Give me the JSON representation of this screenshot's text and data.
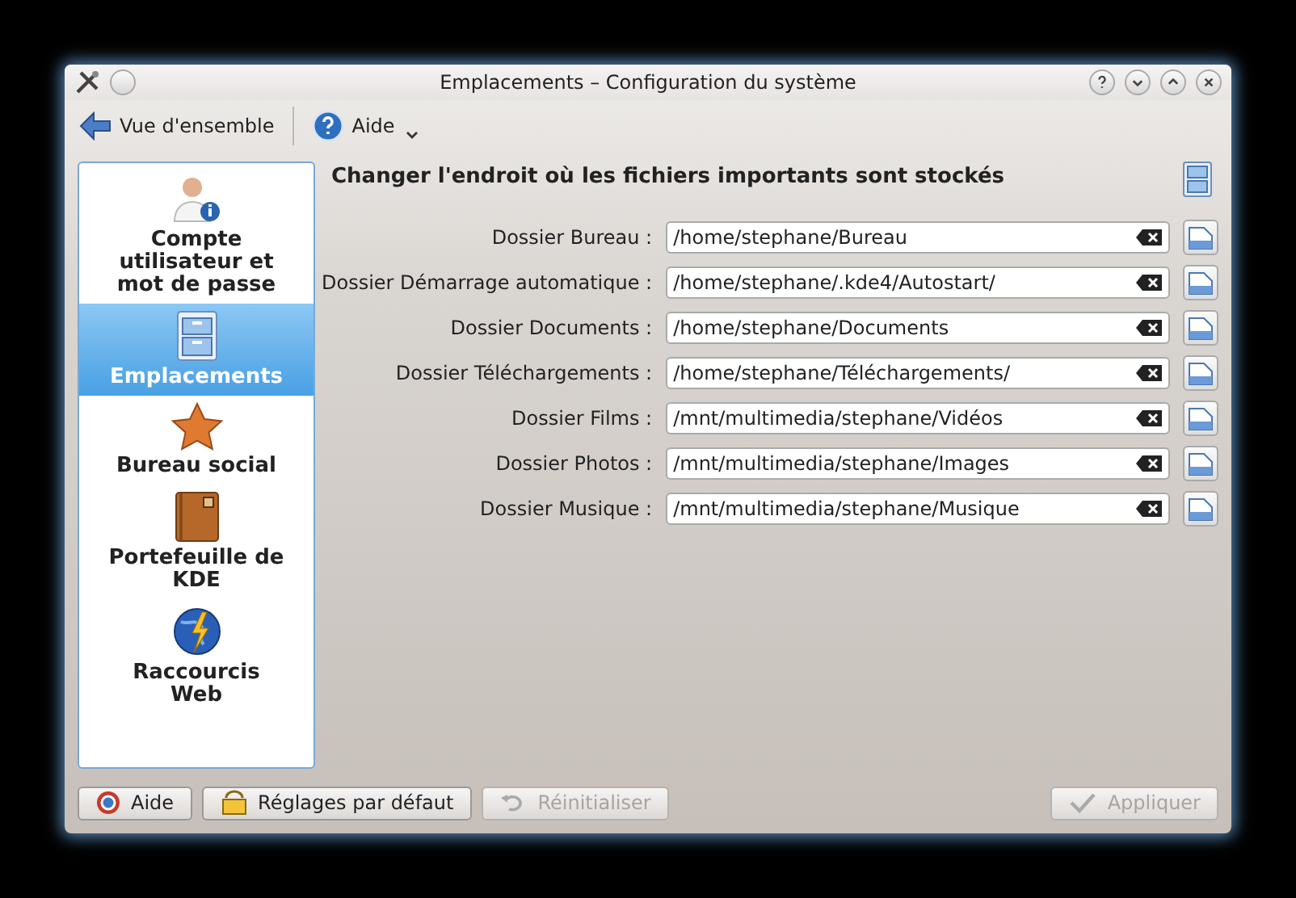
{
  "window": {
    "title": "Emplacements – Configuration du système"
  },
  "toolbar": {
    "items": [
      {
        "label": "Vue d'ensemble",
        "kind": "back"
      },
      {
        "label": "Aide",
        "kind": "help"
      }
    ]
  },
  "sidebar": {
    "items": [
      {
        "label": "Compte utilisateur et mot de passe",
        "kind": "user",
        "selected": false
      },
      {
        "label": "Emplacements",
        "kind": "cabinet",
        "selected": true
      },
      {
        "label": "Bureau social",
        "kind": "star",
        "selected": false
      },
      {
        "label": "Portefeuille de KDE",
        "kind": "wallet",
        "selected": false
      },
      {
        "label": "Raccourcis Web",
        "kind": "globe",
        "selected": false
      }
    ]
  },
  "content": {
    "heading": "Changer l'endroit où les fichiers importants sont stockés",
    "folders": [
      {
        "label": "Dossier Bureau :",
        "value": "/home/stephane/Bureau"
      },
      {
        "label": "Dossier Démarrage automatique :",
        "value": "/home/stephane/.kde4/Autostart/"
      },
      {
        "label": "Dossier Documents :",
        "value": "/home/stephane/Documents"
      },
      {
        "label": "Dossier Téléchargements :",
        "value": "/home/stephane/Téléchargements/"
      },
      {
        "label": "Dossier Films :",
        "value": "/mnt/multimedia/stephane/Vidéos"
      },
      {
        "label": "Dossier Photos :",
        "value": "/mnt/multimedia/stephane/Images"
      },
      {
        "label": "Dossier Musique :",
        "value": "/mnt/multimedia/stephane/Musique"
      }
    ]
  },
  "buttons": [
    {
      "label": "Aide",
      "kind": "help",
      "disabled": false
    },
    {
      "label": "Réglages par défaut",
      "kind": "defaults",
      "disabled": false
    },
    {
      "label": "Réinitialiser",
      "kind": "reset",
      "disabled": true
    },
    {
      "label": "Appliquer",
      "kind": "apply",
      "disabled": true
    }
  ]
}
